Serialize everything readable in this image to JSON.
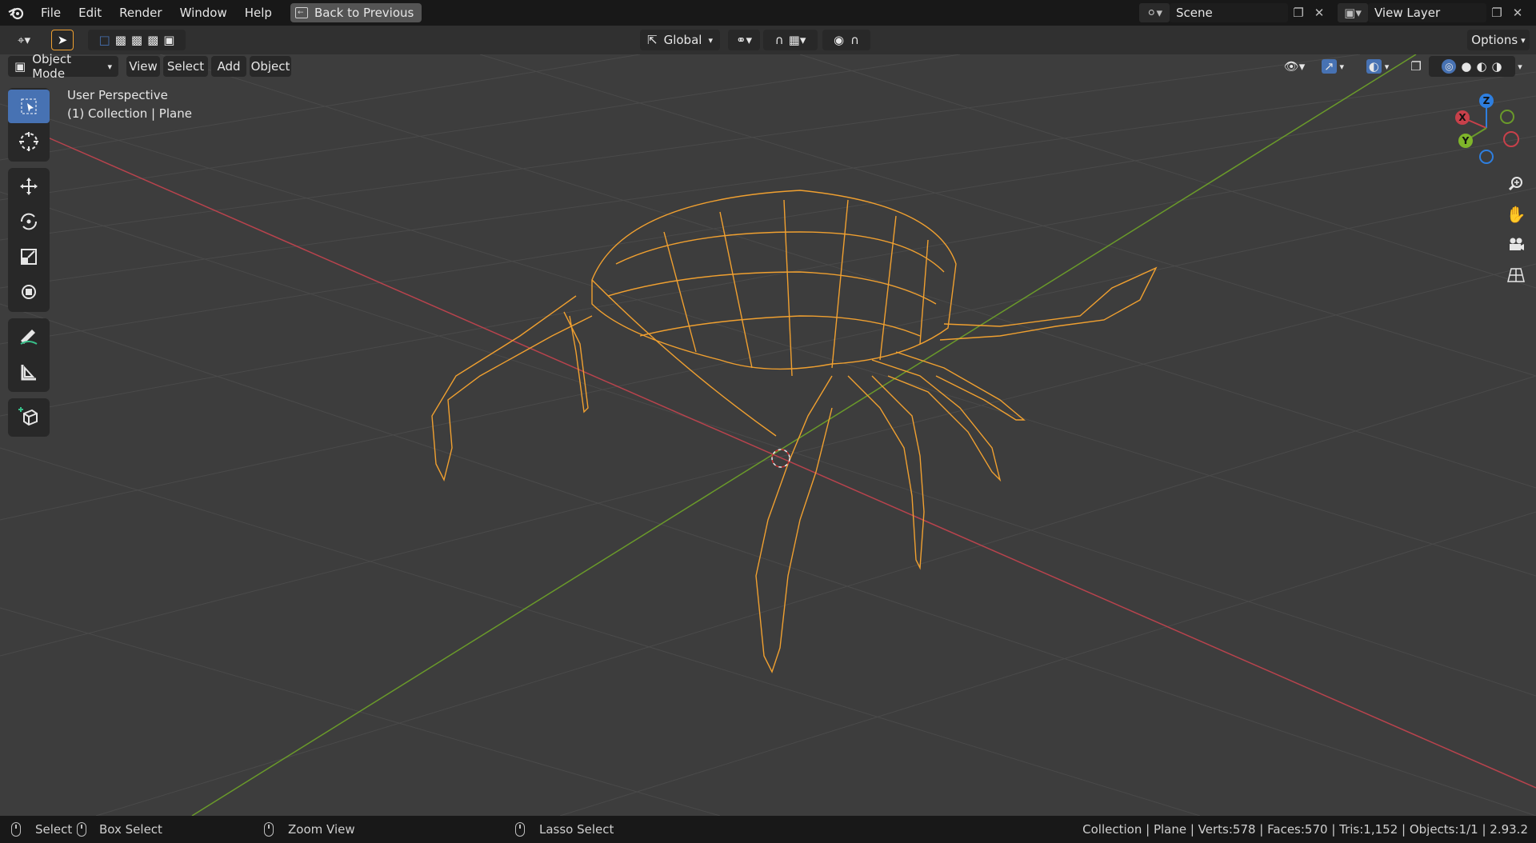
{
  "menubar": {
    "items": [
      "File",
      "Edit",
      "Render",
      "Window",
      "Help"
    ],
    "back_label": "Back to Previous",
    "scene_value": "Scene",
    "viewlayer_value": "View Layer"
  },
  "header1": {
    "orientation": "Global",
    "options_label": "Options"
  },
  "header2": {
    "mode": "Object Mode",
    "menus": [
      "View",
      "Select",
      "Add",
      "Object"
    ]
  },
  "viewport": {
    "perspective_label": "User Perspective",
    "collection_label": "(1) Collection | Plane",
    "gizmo": {
      "x": "X",
      "y": "Y",
      "z": "Z"
    }
  },
  "statusbar": {
    "select": "Select",
    "box_select": "Box Select",
    "zoom_view": "Zoom View",
    "lasso_select": "Lasso Select",
    "stats": "Collection | Plane | Verts:578 | Faces:570 | Tris:1,152 | Objects:1/1 | 2.93.2"
  },
  "colors": {
    "accent": "#4772b3",
    "selection": "#f0a030",
    "x_axis": "#c8404a",
    "y_axis": "#6a9a2a",
    "z_axis": "#2e7fe0"
  }
}
